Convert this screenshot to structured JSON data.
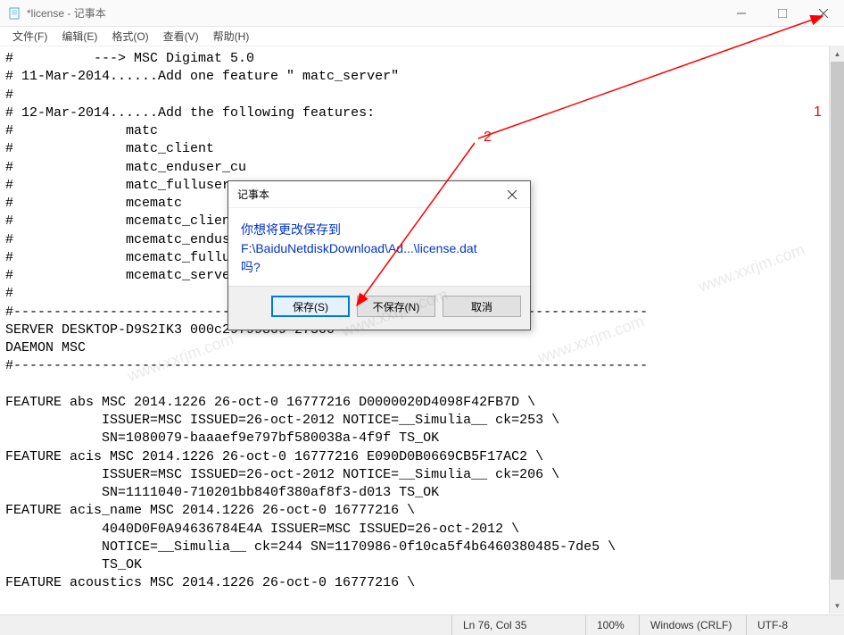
{
  "window": {
    "title": "*license - 记事本"
  },
  "menu": {
    "file": "文件(F)",
    "edit": "编辑(E)",
    "format": "格式(O)",
    "view": "查看(V)",
    "help": "帮助(H)"
  },
  "content": "#          ---> MSC Digimat 5.0\n# 11-Mar-2014......Add one feature \" matc_server\"\n#\n# 12-Mar-2014......Add the following features:\n#              matc\n#              matc_client\n#              matc_enduser_cu\n#              matc_fulluser_nu\n#              mcematc\n#              mcematc_client\n#              mcematc_enduser_nu\n#              mcematc_fulluser_nu\n#              mcematc_server\n#\n#-------------------------------------------------------------------------------\nSERVER DESKTOP-D9S2IK3 000c29799809 27500\nDAEMON MSC\n#-------------------------------------------------------------------------------\n\nFEATURE abs MSC 2014.1226 26-oct-0 16777216 D0000020D4098F42FB7D \\\n            ISSUER=MSC ISSUED=26-oct-2012 NOTICE=__Simulia__ ck=253 \\\n            SN=1080079-baaaef9e797bf580038a-4f9f TS_OK\nFEATURE acis MSC 2014.1226 26-oct-0 16777216 E090D0B0669CB5F17AC2 \\\n            ISSUER=MSC ISSUED=26-oct-2012 NOTICE=__Simulia__ ck=206 \\\n            SN=1111040-710201bb840f380af8f3-d013 TS_OK\nFEATURE acis_name MSC 2014.1226 26-oct-0 16777216 \\\n            4040D0F0A94636784E4A ISSUER=MSC ISSUED=26-oct-2012 \\\n            NOTICE=__Simulia__ ck=244 SN=1170986-0f10ca5f4b6460380485-7de5 \\\n            TS_OK\nFEATURE acoustics MSC 2014.1226 26-oct-0 16777216 \\",
  "dialog": {
    "title": "记事本",
    "line1": "你想将更改保存到",
    "line2": "F:\\BaiduNetdiskDownload\\Ad...\\license.dat",
    "line3": "吗?",
    "save": "保存(S)",
    "nosave": "不保存(N)",
    "cancel": "取消"
  },
  "status": {
    "position": "Ln 76,  Col 35",
    "zoom": "100%",
    "lineending": "Windows (CRLF)",
    "encoding": "UTF-8"
  },
  "annotations": {
    "label1": "1",
    "label2": "2"
  },
  "watermark": "www.xxrjm.com"
}
